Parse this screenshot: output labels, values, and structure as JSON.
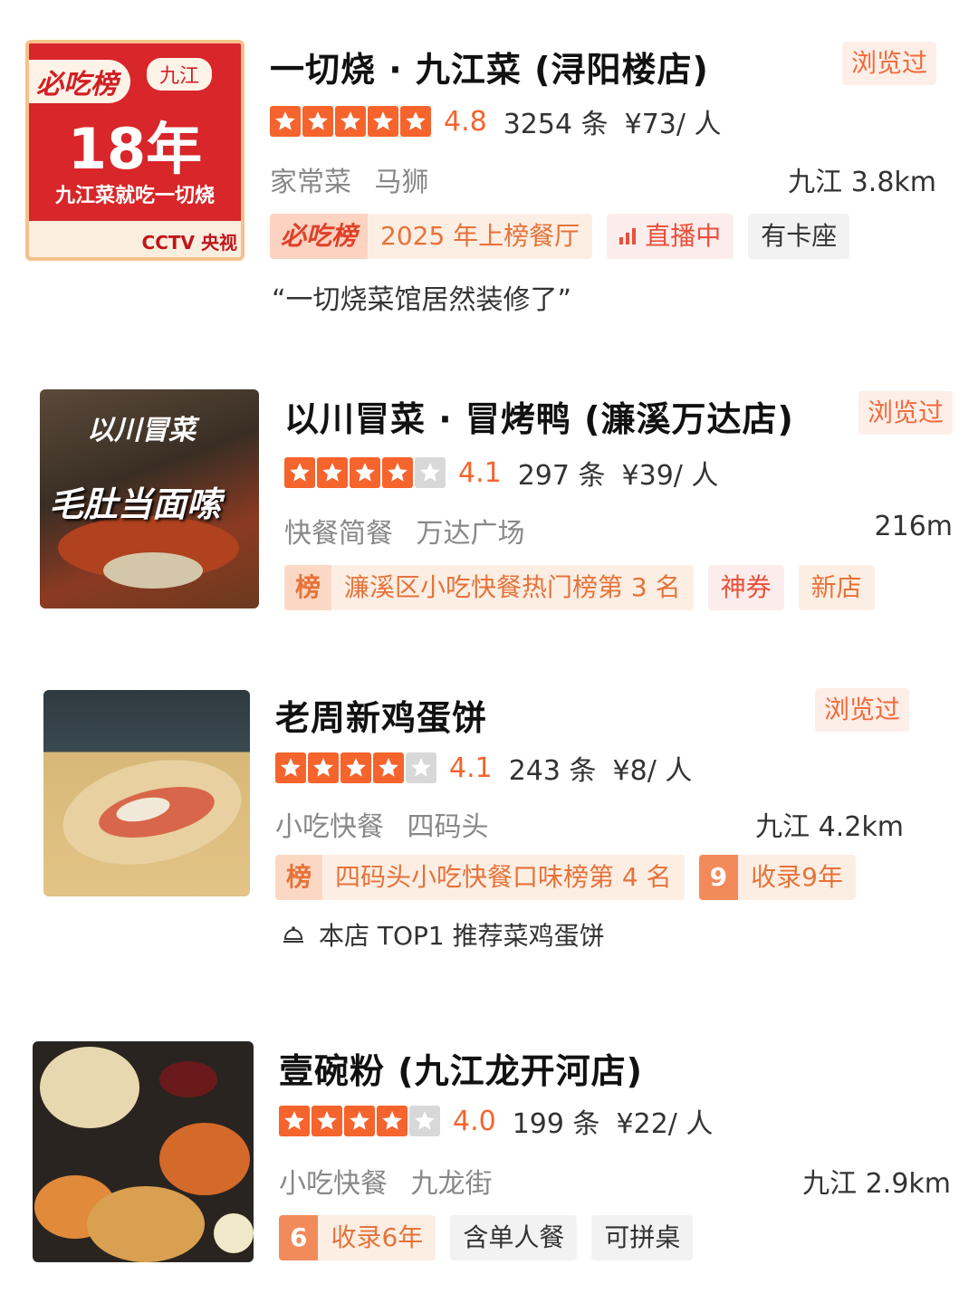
{
  "restaurants": [
    {
      "name": "一切烧 · 九江菜 (浔阳楼店)",
      "viewed": "浏览过",
      "score": "4.8",
      "stars": 5,
      "reviews": "3254 条",
      "price": "¥73/ 人",
      "category": "家常菜",
      "area": "马狮",
      "distance": "九江 3.8km",
      "tags": [
        "必吃榜",
        "2025 年上榜餐厅",
        "直播中",
        "有卡座"
      ],
      "quote": "“一切烧菜馆居然装修了”",
      "thumb": {
        "badge": "必吃榜",
        "city": "九江",
        "big": "18年",
        "line": "九江菜就吃一切烧",
        "footer": "CCTV 央视"
      }
    },
    {
      "name": "以川冒菜 · 冒烤鸭 (濂溪万达店)",
      "viewed": "浏览过",
      "score": "4.1",
      "stars": 4,
      "reviews": "297 条",
      "price": "¥39/ 人",
      "category": "快餐简餐",
      "area": "万达广场",
      "distance": "216m",
      "tags": [
        "榜",
        "濂溪区小吃快餐热门榜第 3 名",
        "神券",
        "新店"
      ],
      "thumb": {
        "line1": "以川冒菜",
        "line2": "毛肚当面嗦"
      }
    },
    {
      "name": "老周新鸡蛋饼",
      "viewed": "浏览过",
      "score": "4.1",
      "stars": 4,
      "reviews": "243 条",
      "price": "¥8/ 人",
      "category": "小吃快餐",
      "area": "四码头",
      "distance": "九江 4.2km",
      "tags": [
        "榜",
        "四码头小吃快餐口味榜第 4 名",
        "9",
        "收录9年"
      ],
      "recommend": "本店 TOP1 推荐菜鸡蛋饼"
    },
    {
      "name": "壹碗粉 (九江龙开河店)",
      "score": "4.0",
      "stars": 4,
      "reviews": "199 条",
      "price": "¥22/ 人",
      "category": "小吃快餐",
      "area": "九龙街",
      "distance": "九江 2.9km",
      "tags": [
        "6",
        "收录6年",
        "含单人餐",
        "可拼桌"
      ]
    }
  ]
}
